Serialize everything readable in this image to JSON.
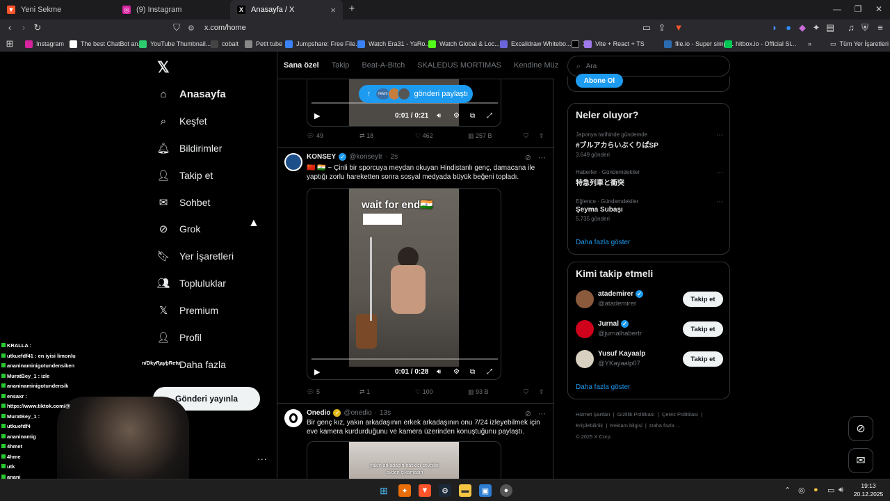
{
  "browser": {
    "tabs": [
      {
        "label": "Yeni Sekme",
        "icon": "brave-icon"
      },
      {
        "label": "(9) Instagram",
        "icon": "instagram-icon"
      },
      {
        "label": "Anasayfa / X",
        "icon": "x-logo-icon",
        "active": true
      }
    ],
    "url": "x.com/home",
    "bookmarks": [
      {
        "label": "Instagram",
        "color": "#d6249f"
      },
      {
        "label": "The best ChatBot an...",
        "color": "#ffffff"
      },
      {
        "label": "YouTube Thumbnail...",
        "color": "#2ecc71"
      },
      {
        "label": "cobalt",
        "color": "#444444"
      },
      {
        "label": "Petit tube",
        "color": "#888888"
      },
      {
        "label": "Jumpshare: Free File...",
        "color": "#3b82f6"
      },
      {
        "label": "Watch Era31 - YaRo...",
        "color": "#3b82f6"
      },
      {
        "label": "Watch Global & Loc...",
        "color": "#53fc18"
      },
      {
        "label": "Excalidraw Whitebo...",
        "color": "#6965db"
      },
      {
        "label": "X",
        "color": "#000000"
      },
      {
        "label": "Vite + React + TS",
        "color": "#9f7aea"
      },
      {
        "label": "file.io - Super simpl...",
        "color": "#2b6cb0"
      },
      {
        "label": "hitbox.io - Official Si...",
        "color": "#00c853"
      }
    ],
    "all_bookmarks": "Tüm Yer İşaretleri"
  },
  "nav": {
    "items": [
      {
        "label": "Anasayfa",
        "icon": "home-icon",
        "glyph": "⌂"
      },
      {
        "label": "Keşfet",
        "icon": "search-icon",
        "glyph": "⌕"
      },
      {
        "label": "Bildirimler",
        "icon": "bell-icon",
        "glyph": "🔔︎"
      },
      {
        "label": "Takip et",
        "icon": "person-plus-icon",
        "glyph": "👤︎"
      },
      {
        "label": "Sohbet",
        "icon": "mail-icon",
        "glyph": "✉"
      },
      {
        "label": "Grok",
        "icon": "grok-icon",
        "glyph": "⊘"
      },
      {
        "label": "Yer İşaretleri",
        "icon": "bookmark-icon",
        "glyph": "🔖︎"
      },
      {
        "label": "Topluluklar",
        "icon": "people-icon",
        "glyph": "👥︎"
      },
      {
        "label": "Premium",
        "icon": "x-logo-icon",
        "glyph": "𝕏"
      },
      {
        "label": "Profil",
        "icon": "person-icon",
        "glyph": "👤︎"
      },
      {
        "label": "Daha fazla",
        "icon": "more-circle-icon",
        "glyph": "⋯"
      }
    ],
    "post_button": "Gönderi yayınla",
    "more_dots": "..."
  },
  "feed": {
    "tabs": [
      "Sana özel",
      "Takip",
      "Beat-A-Bitch",
      "SKALEDUS MORTIMAS",
      "Kendine Müz"
    ],
    "share_pill": "gönderi paylaştı",
    "share_news": "news",
    "tweets": [
      {
        "video_time": "0:01 / 0:21",
        "replies": "49",
        "retweets": "18",
        "likes": "462",
        "views": "257 B"
      },
      {
        "name": "KONSEY",
        "handle": "@konseytr",
        "time": "2s",
        "flags": "🇨🇳 🇮🇳",
        "text": "~ Çinli bir sporcuya meydan okuyan Hindistanlı genç, damacana ile yaptığı zorlu hareketten sonra sosyal medyada büyük beğeni topladı.",
        "video_overlay": "wait for end🇮🇳",
        "video_time": "0:01 / 0:28",
        "replies": "5",
        "retweets": "1",
        "likes": "100",
        "views": "93 B"
      },
      {
        "name": "Onedio",
        "handle": "@onedio",
        "time": "13s",
        "text": "Bir genç kız, yakın arkadaşının erkek arkadaşının onu 7/24 izleyebilmek için eve kamera kurdurduğunu ve kamera üzerinden konuştuğunu paylaştı.",
        "video_caption": "yakın arkadaşın baskıcı sevgilisi evden çıkamasın"
      }
    ]
  },
  "sidebar": {
    "search_placeholder": "Ara",
    "subscribe": "Abone Ol",
    "trends_title": "Neler oluyor?",
    "trends": [
      {
        "context": "Japonya tarihinde gündemde",
        "title": "#ブルアカらいぶくりぱSP",
        "count": "3.649 gönderi"
      },
      {
        "context": "Haberler · Gündemdekiler",
        "title": "特急列車と衝突",
        "count": ""
      },
      {
        "context": "Eğlence · Gündemdekiler",
        "title": "Şeyma Subaşı",
        "count": "5.735 gönderi"
      }
    ],
    "show_more": "Daha fazla göster",
    "who_title": "Kimi takip etmeli",
    "who": [
      {
        "name": "atademirer",
        "handle": "@atademirer",
        "color": "#8b5a3c"
      },
      {
        "name": "Jurnal",
        "handle": "@jurnalhabertr",
        "color": "#d0021b"
      },
      {
        "name": "Yusuf Kayaalp",
        "handle": "@YKayaalp07",
        "color": "#d8d0c0"
      }
    ],
    "follow_label": "Takip et",
    "footer": [
      "Hizmet Şartları",
      "Gizlilik Politikası",
      "Çerez Politikası",
      "Erişilebilirlik",
      "Reklam bilgisi",
      "Daha fazla ...",
      "© 2025 X Corp."
    ]
  },
  "chat": [
    {
      "text": "KRALLA :"
    },
    {
      "text": "utkuefdf41 : en iyisi limonlu"
    },
    {
      "text": "ananinaminigotundensiken"
    },
    {
      "text": "MuratBey_1 : izle"
    },
    {
      "text": "ananinaminigotundensik"
    },
    {
      "text": "ensaxr :"
    },
    {
      "text": "https://www.tiktok.com/@"
    },
    {
      "text": "MuratBey_1 :"
    },
    {
      "text": "utkuefdf4"
    },
    {
      "text": "ananinamig"
    },
    {
      "text": "4hmet"
    },
    {
      "text": "4hme"
    },
    {
      "text": "utk"
    },
    {
      "text": "anani"
    },
    {
      "text": "4hm"
    }
  ],
  "chat_extra": "n/DkyRaybRetu",
  "taskbar": {
    "time": "19:13",
    "date": "20.12.2025"
  },
  "colors": {
    "accent": "#1d9bf0",
    "background": "#000000",
    "border": "#2f3336",
    "muted": "#71767b"
  }
}
